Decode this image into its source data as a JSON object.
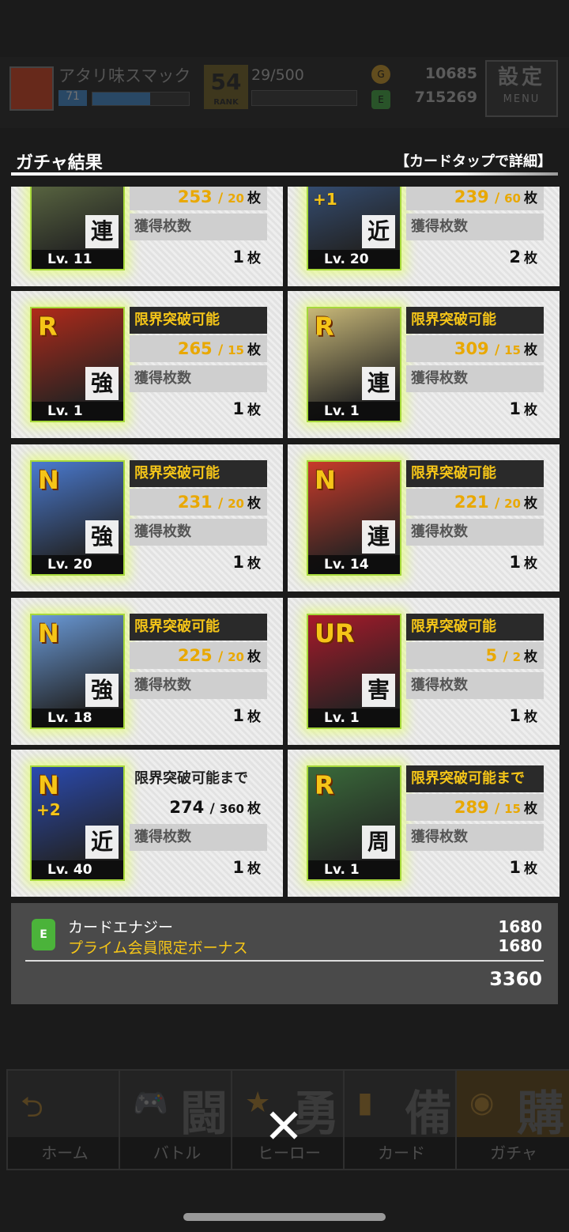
{
  "header": {
    "player_name": "アタリ味スマック",
    "player_level": "71",
    "rank": "54",
    "rank_label": "RANK",
    "rank_progress": "29/500",
    "currency1_icon": "coin-icon",
    "currency1": "10685",
    "currency2_icon": "energy-icon",
    "currency2": "715269",
    "menu_label": "設定",
    "menu_sub": "MENU"
  },
  "title": "ガチャ結果",
  "hint": "【カードタップで詳細】",
  "cards": [
    {
      "rarity": "",
      "plus": "",
      "kanji": "連",
      "level": "Lv. 11",
      "label1": "",
      "count": "253",
      "max": "20",
      "unit": "枚",
      "label2": "獲得枚数",
      "got": "1",
      "art": "#6a7a4a"
    },
    {
      "rarity": "",
      "plus": "+1",
      "kanji": "近",
      "level": "Lv. 20",
      "label1": "",
      "count": "239",
      "max": "60",
      "unit": "枚",
      "label2": "獲得枚数",
      "got": "2",
      "art": "#3a5a8a"
    },
    {
      "rarity": "R",
      "plus": "",
      "kanji": "強",
      "level": "Lv. 1",
      "label1": "限界突破可能",
      "count": "265",
      "max": "15",
      "unit": "枚",
      "label2": "獲得枚数",
      "got": "1",
      "art": "#b02a1a"
    },
    {
      "rarity": "R",
      "plus": "",
      "kanji": "連",
      "level": "Lv. 1",
      "label1": "限界突破可能",
      "count": "309",
      "max": "15",
      "unit": "枚",
      "label2": "獲得枚数",
      "got": "1",
      "art": "#c8b878"
    },
    {
      "rarity": "N",
      "plus": "",
      "kanji": "強",
      "level": "Lv. 20",
      "label1": "限界突破可能",
      "count": "231",
      "max": "20",
      "unit": "枚",
      "label2": "獲得枚数",
      "got": "1",
      "art": "#4a7ad0"
    },
    {
      "rarity": "N",
      "plus": "",
      "kanji": "連",
      "level": "Lv. 14",
      "label1": "限界突破可能",
      "count": "221",
      "max": "20",
      "unit": "枚",
      "label2": "獲得枚数",
      "got": "1",
      "art": "#c83a2a"
    },
    {
      "rarity": "N",
      "plus": "",
      "kanji": "強",
      "level": "Lv. 18",
      "label1": "限界突破可能",
      "count": "225",
      "max": "20",
      "unit": "枚",
      "label2": "獲得枚数",
      "got": "1",
      "art": "#6a9ad8"
    },
    {
      "rarity": "UR",
      "plus": "",
      "kanji": "害",
      "level": "Lv. 1",
      "label1": "限界突破可能",
      "count": "5",
      "max": "2",
      "unit": "枚",
      "label2": "獲得枚数",
      "got": "1",
      "art": "#a81a2a"
    },
    {
      "rarity": "N",
      "plus": "+2",
      "kanji": "近",
      "level": "Lv. 40",
      "label1": "限界突破可能まで",
      "count": "274",
      "max": "360",
      "unit": "枚",
      "label2": "獲得枚数",
      "got": "1",
      "art": "#2a4ab0",
      "plain": true
    },
    {
      "rarity": "R",
      "plus": "",
      "kanji": "周",
      "level": "Lv. 1",
      "label1": "限界突破可能まで",
      "count": "289",
      "max": "15",
      "unit": "枚",
      "label2": "獲得枚数",
      "got": "1",
      "art": "#3a6a3a"
    }
  ],
  "energy": {
    "label1": "カードエナジー",
    "label2": "プライム会員限定ボーナス",
    "value1": "1680",
    "value2": "1680",
    "total": "3360"
  },
  "nav": [
    {
      "kanji": "",
      "icon": "⮌",
      "label": "ホーム"
    },
    {
      "kanji": "闘",
      "icon": "🎮",
      "label": "バトル"
    },
    {
      "kanji": "勇",
      "icon": "★",
      "label": "ヒーロー"
    },
    {
      "kanji": "備",
      "icon": "▮",
      "label": "カード"
    },
    {
      "kanji": "購",
      "icon": "◉",
      "label": "ガチャ"
    }
  ],
  "close_label": "✕"
}
